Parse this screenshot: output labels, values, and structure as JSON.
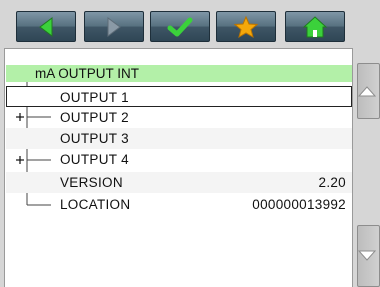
{
  "toolbar": {
    "buttons": [
      {
        "name": "back",
        "icon": "arrow-left-icon",
        "color": "#3bd13b"
      },
      {
        "name": "forward",
        "icon": "arrow-right-icon",
        "color": "#8a9aa6"
      },
      {
        "name": "confirm",
        "icon": "checkmark-icon",
        "color": "#3bd13b"
      },
      {
        "name": "favorite",
        "icon": "star-icon",
        "color": "#f5a80a"
      },
      {
        "name": "home",
        "icon": "home-icon",
        "color": "#3bd13b"
      }
    ]
  },
  "tree": {
    "header": "mA OUTPUT INT",
    "items": [
      {
        "label": "OUTPUT 1",
        "value": "",
        "expandable": true,
        "selected": true
      },
      {
        "label": "OUTPUT 2",
        "value": "",
        "expandable": true,
        "selected": false
      },
      {
        "label": "OUTPUT 3",
        "value": "",
        "expandable": true,
        "selected": false
      },
      {
        "label": "OUTPUT 4",
        "value": "",
        "expandable": true,
        "selected": false
      },
      {
        "label": "VERSION",
        "value": "2.20",
        "expandable": false,
        "selected": false
      },
      {
        "label": "LOCATION",
        "value": "000000013992",
        "expandable": false,
        "selected": false
      }
    ]
  },
  "colors": {
    "header_bg": "#b3f0a8",
    "toolbar_button": "#56707f",
    "panel_bg": "#ffffff"
  }
}
